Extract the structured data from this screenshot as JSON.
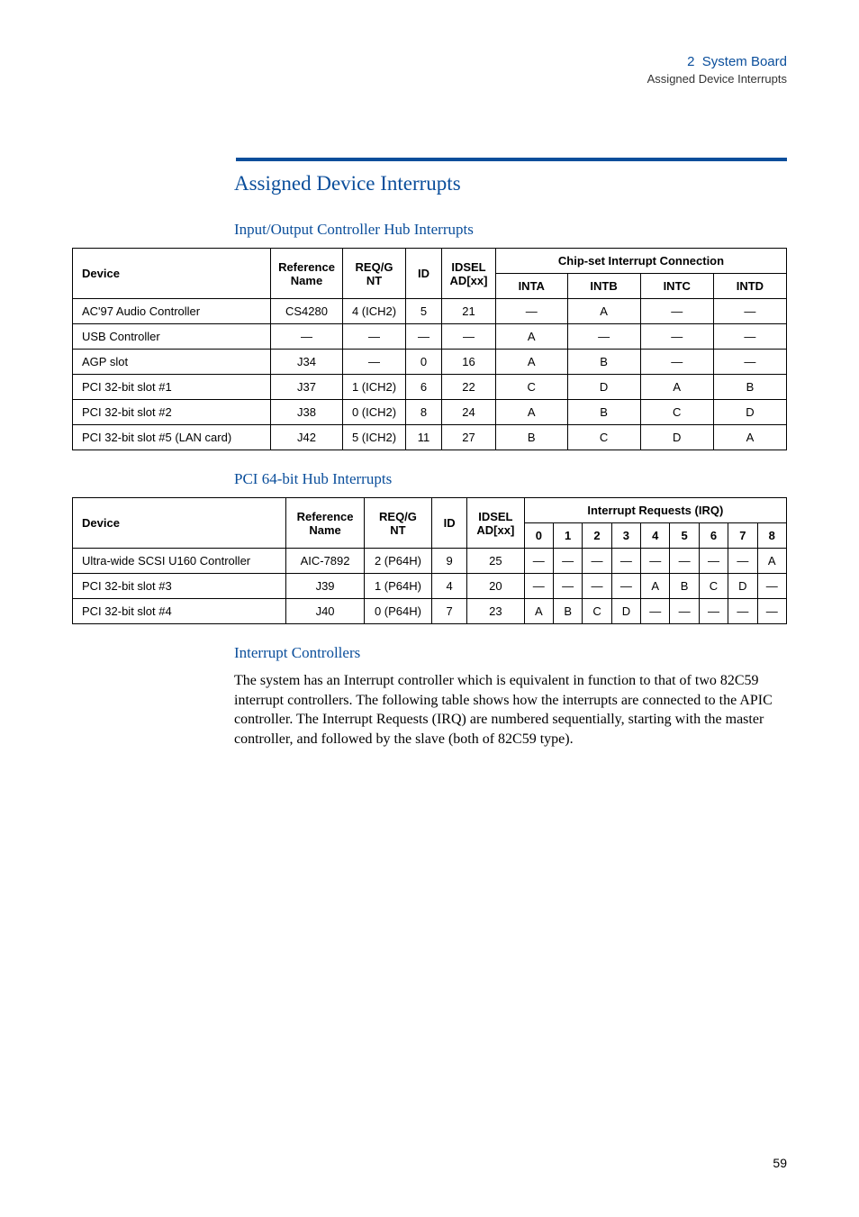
{
  "header": {
    "chapter_num": "2",
    "chapter_title": "System Board",
    "section": "Assigned Device Interrupts"
  },
  "title": "Assigned Device Interrupts",
  "table1": {
    "heading": "Input/Output Controller Hub Interrupts",
    "cols": {
      "device": "Device",
      "ref": "Reference Name",
      "reqg": "REQ/G NT",
      "id": "ID",
      "idsel": "IDSEL AD[xx]",
      "chipset": "Chip-set Interrupt Connection",
      "inta": "INTA",
      "intb": "INTB",
      "intc": "INTC",
      "intd": "INTD"
    },
    "rows": [
      {
        "device": "AC'97 Audio Controller",
        "ref": "CS4280",
        "reqg": "4 (ICH2)",
        "id": "5",
        "idsel": "21",
        "a": "—",
        "b": "A",
        "c": "—",
        "d": "—"
      },
      {
        "device": "USB Controller",
        "ref": "—",
        "reqg": "—",
        "id": "—",
        "idsel": "—",
        "a": "A",
        "b": "—",
        "c": "—",
        "d": "—"
      },
      {
        "device": "AGP slot",
        "ref": "J34",
        "reqg": "—",
        "id": "0",
        "idsel": "16",
        "a": "A",
        "b": "B",
        "c": "—",
        "d": "—"
      },
      {
        "device": "PCI 32-bit slot #1",
        "ref": "J37",
        "reqg": "1 (ICH2)",
        "id": "6",
        "idsel": "22",
        "a": "C",
        "b": "D",
        "c": "A",
        "d": "B"
      },
      {
        "device": "PCI 32-bit slot #2",
        "ref": "J38",
        "reqg": "0 (ICH2)",
        "id": "8",
        "idsel": "24",
        "a": "A",
        "b": "B",
        "c": "C",
        "d": "D"
      },
      {
        "device": "PCI 32-bit slot #5 (LAN card)",
        "ref": "J42",
        "reqg": "5 (ICH2)",
        "id": "11",
        "idsel": "27",
        "a": "B",
        "b": "C",
        "c": "D",
        "d": "A"
      }
    ]
  },
  "table2": {
    "heading": "PCI 64-bit Hub Interrupts",
    "cols": {
      "device": "Device",
      "ref": "Reference Name",
      "reqg": "REQ/G NT",
      "id": "ID",
      "idsel": "IDSEL AD[xx]",
      "irq": "Interrupt Requests (IRQ)",
      "c0": "0",
      "c1": "1",
      "c2": "2",
      "c3": "3",
      "c4": "4",
      "c5": "5",
      "c6": "6",
      "c7": "7",
      "c8": "8"
    },
    "rows": [
      {
        "device": "Ultra-wide SCSI U160 Controller",
        "ref": "AIC-7892",
        "reqg": "2 (P64H)",
        "id": "9",
        "idsel": "25",
        "v": [
          "—",
          "—",
          "—",
          "—",
          "—",
          "—",
          "—",
          "—",
          "A"
        ]
      },
      {
        "device": "PCI 32-bit slot #3",
        "ref": "J39",
        "reqg": "1 (P64H)",
        "id": "4",
        "idsel": "20",
        "v": [
          "—",
          "—",
          "—",
          "—",
          "A",
          "B",
          "C",
          "D",
          "—"
        ]
      },
      {
        "device": "PCI 32-bit slot #4",
        "ref": "J40",
        "reqg": "0 (P64H)",
        "id": "7",
        "idsel": "23",
        "v": [
          "A",
          "B",
          "C",
          "D",
          "—",
          "—",
          "—",
          "—",
          "—"
        ]
      }
    ]
  },
  "interrupt_controllers": {
    "heading": "Interrupt Controllers",
    "para": "The system has an Interrupt controller which is equivalent in function to that of two 82C59 interrupt controllers. The following table shows how the interrupts are connected to the APIC controller. The Interrupt Requests (IRQ) are numbered sequentially, starting with the master controller, and followed by the slave (both of 82C59 type)."
  },
  "page_number": "59"
}
